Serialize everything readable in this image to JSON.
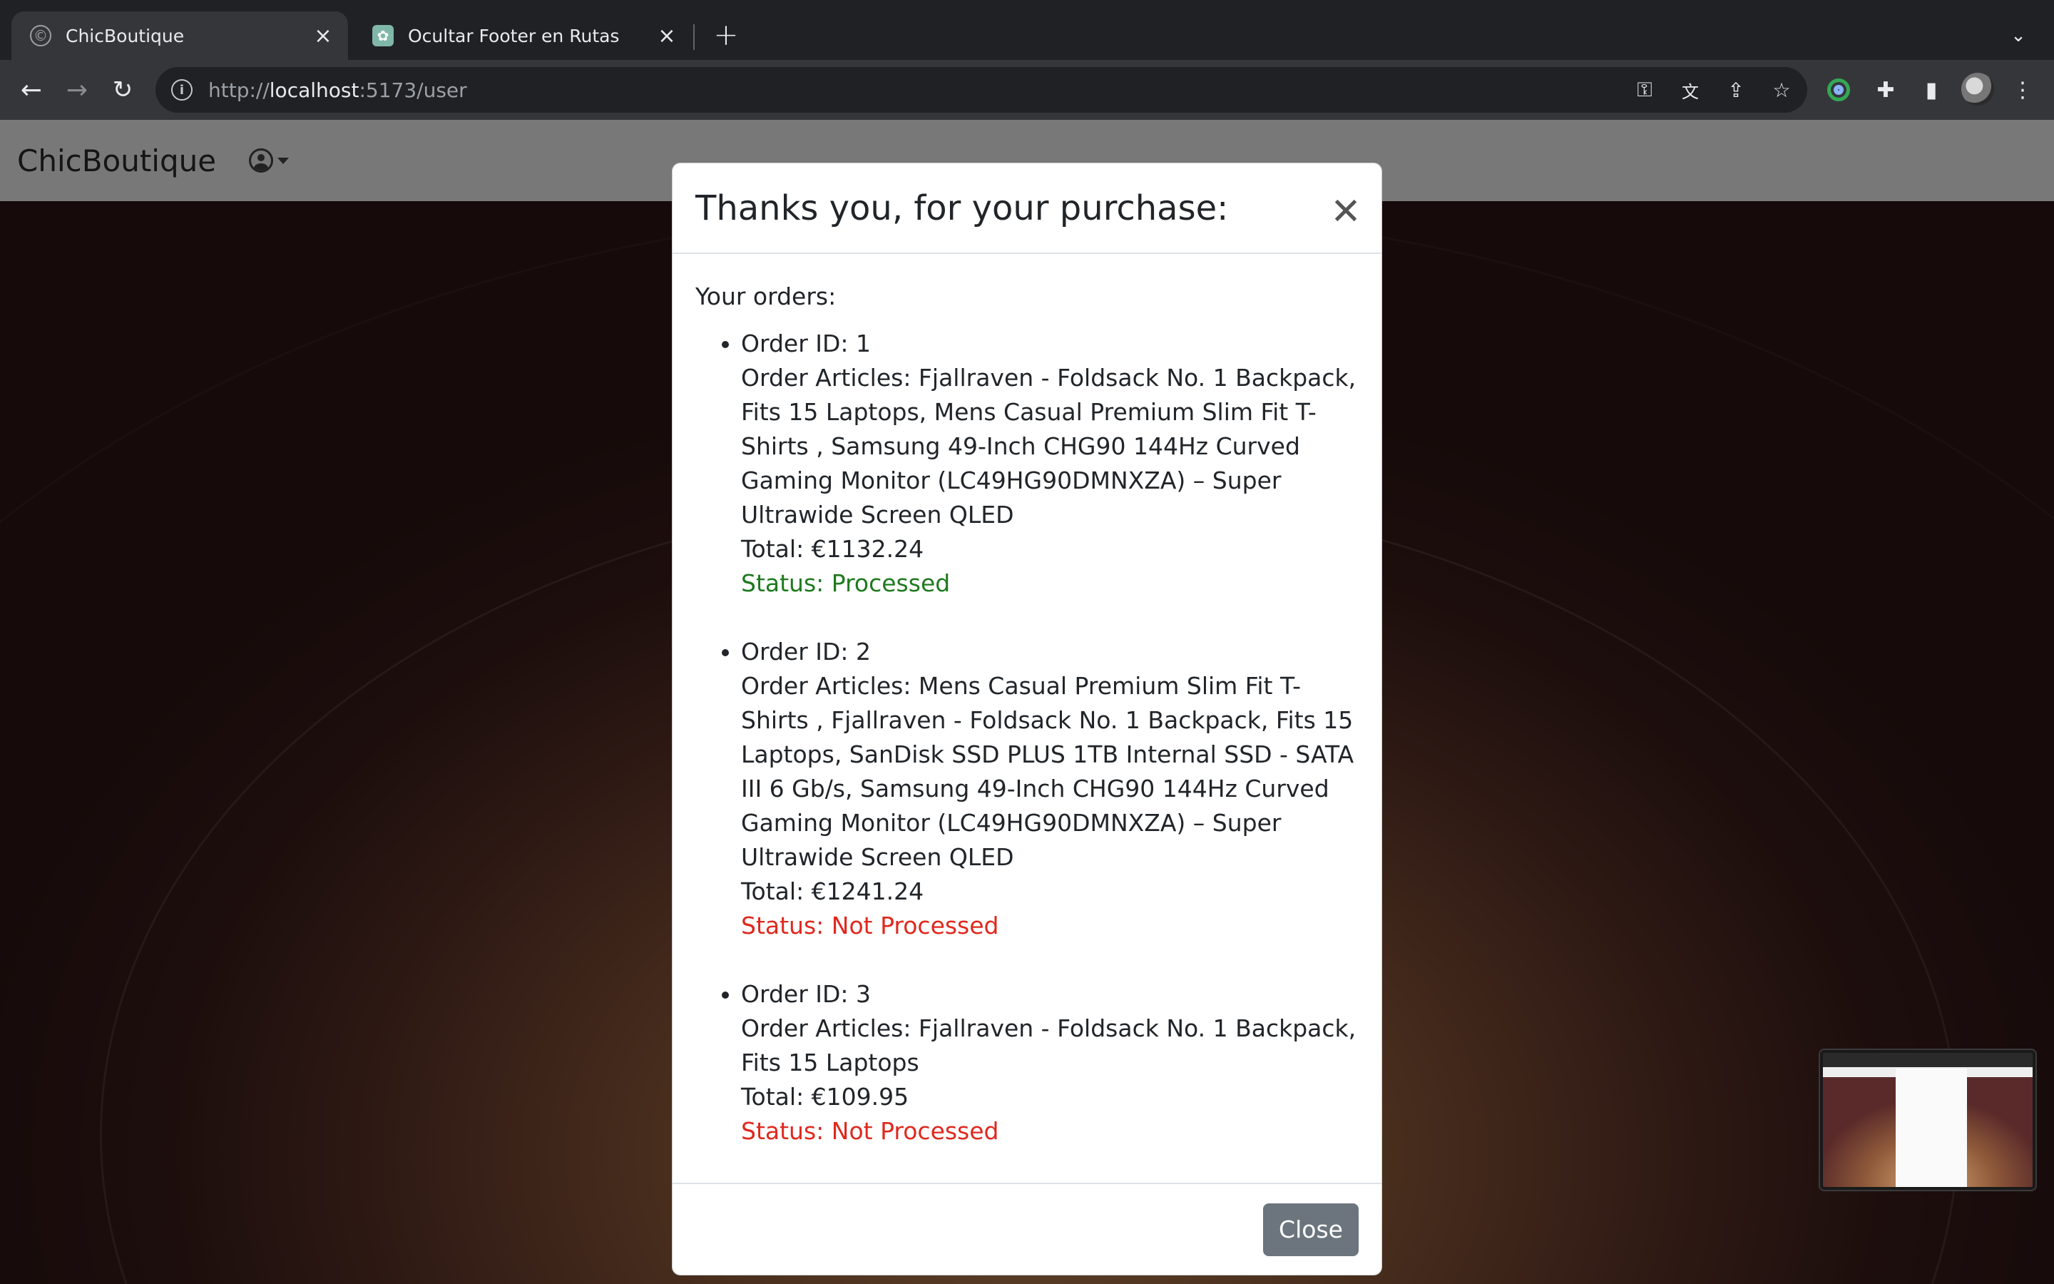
{
  "browser": {
    "tabs": [
      {
        "title": "ChicBoutique",
        "favicon": "c",
        "active": true
      },
      {
        "title": "Ocultar Footer en Rutas",
        "favicon": "openai-icon",
        "active": false
      }
    ],
    "url_scheme": "http://",
    "url_host": "localhost",
    "url_rest": ":5173/user"
  },
  "navbar": {
    "brand": "ChicBoutique"
  },
  "modal": {
    "title": "Thanks you, for your purchase:",
    "intro": "Your orders:",
    "orders": [
      {
        "id_line": "Order ID: 1",
        "articles_line": "Order Articles: Fjallraven - Foldsack No. 1 Backpack, Fits 15 Laptops, Mens Casual Premium Slim Fit T-Shirts , Samsung 49-Inch CHG90 144Hz Curved Gaming Monitor (LC49HG90DMNXZA) – Super Ultrawide Screen QLED",
        "total_line": "Total: €1132.24",
        "status_line": "Status: Processed",
        "status_color": "#1e7a1e"
      },
      {
        "id_line": "Order ID: 2",
        "articles_line": "Order Articles: Mens Casual Premium Slim Fit T-Shirts , Fjallraven - Foldsack No. 1 Backpack, Fits 15 Laptops, SanDisk SSD PLUS 1TB Internal SSD - SATA III 6 Gb/s, Samsung 49-Inch CHG90 144Hz Curved Gaming Monitor (LC49HG90DMNXZA) – Super Ultrawide Screen QLED",
        "total_line": "Total: €1241.24",
        "status_line": "Status: Not Processed",
        "status_color": "#e0281e"
      },
      {
        "id_line": "Order ID: 3",
        "articles_line": "Order Articles: Fjallraven - Foldsack No. 1 Backpack, Fits 15 Laptops",
        "total_line": "Total: €109.95",
        "status_line": "Status: Not Processed",
        "status_color": "#e0281e"
      }
    ],
    "close_label": "Close",
    "close_button_color": "#6c757d"
  }
}
